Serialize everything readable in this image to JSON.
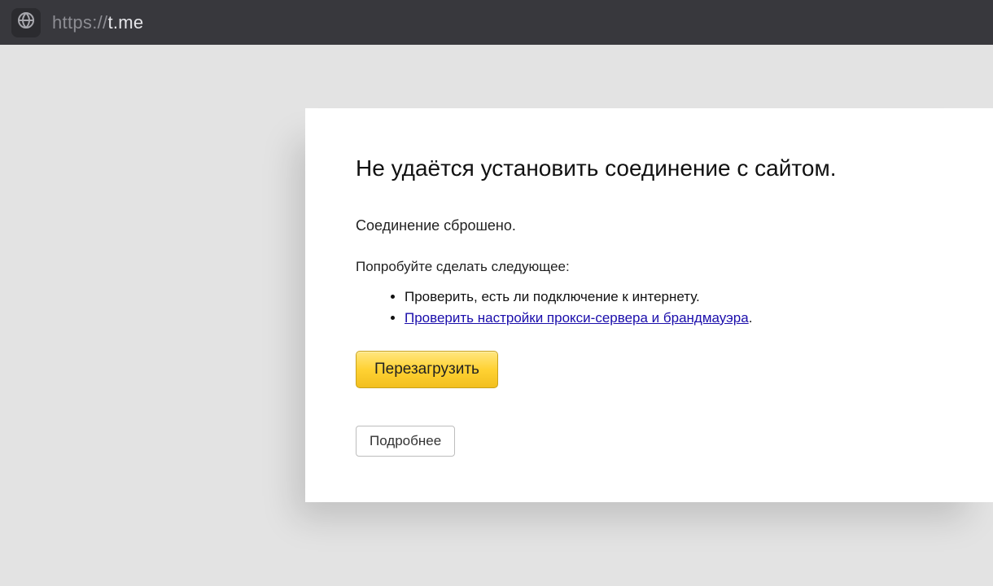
{
  "addressbar": {
    "url_protocol": "https://",
    "url_host": "t.me"
  },
  "error": {
    "title": "Не удаётся установить соединение с сайтом.",
    "subtitle": "Соединение сброшено.",
    "try_label": "Попробуйте сделать следующее:",
    "suggestions": {
      "item1": "Проверить, есть ли подключение к интернету.",
      "item2_link": "Проверить настройки прокси-сервера и брандмауэра",
      "item2_period": "."
    },
    "reload_button": "Перезагрузить",
    "more_button": "Подробнее"
  }
}
